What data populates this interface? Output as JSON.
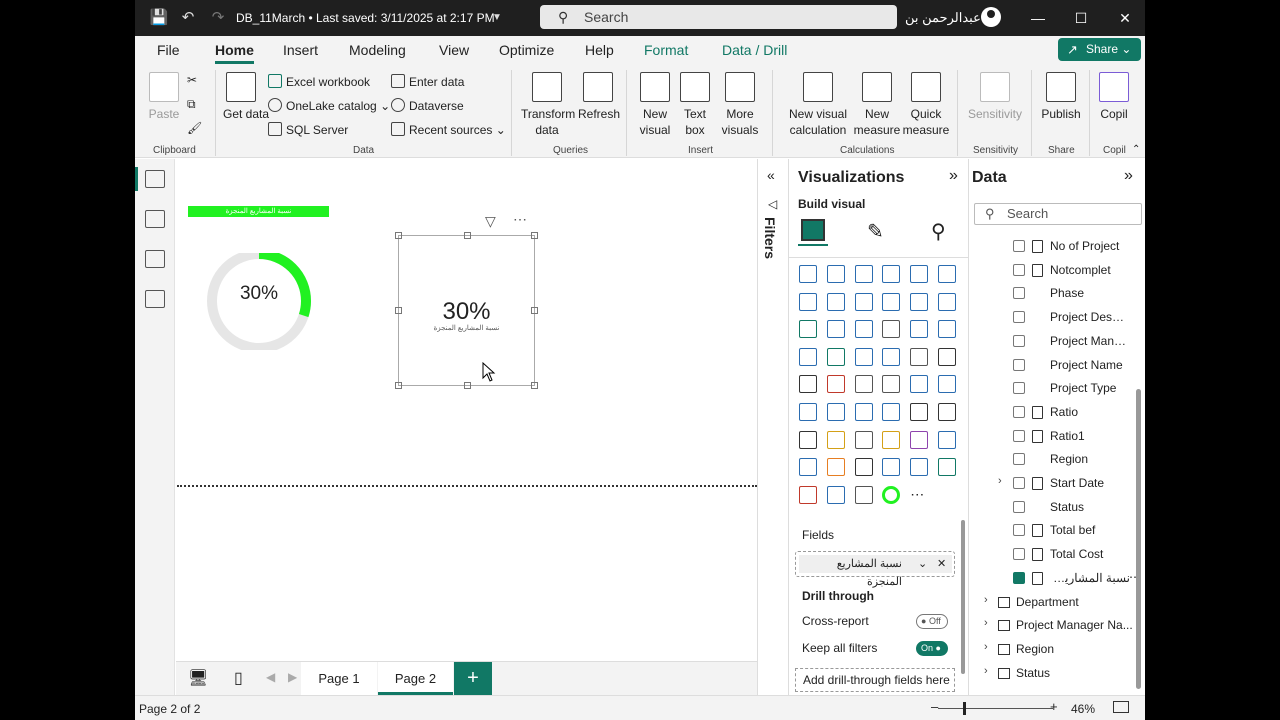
{
  "titlebar": {
    "title": "DB_11March • Last saved: 3/11/2025 at 2:17 PM",
    "search_placeholder": "Search",
    "user_name": "عبدالرحمن بن"
  },
  "menu": {
    "tabs": [
      "File",
      "Home",
      "Insert",
      "Modeling",
      "View",
      "Optimize",
      "Help",
      "Format",
      "Data / Drill"
    ],
    "active": "Home",
    "share_label": "Share"
  },
  "ribbon": {
    "clipboard": {
      "paste": "Paste",
      "label": "Clipboard"
    },
    "data": {
      "get_data": "Get data",
      "excel": "Excel workbook",
      "onelake": "OneLake catalog",
      "sql": "SQL Server",
      "enter_data": "Enter data",
      "dataverse": "Dataverse",
      "recent": "Recent sources",
      "label": "Data"
    },
    "queries": {
      "transform": "Transform data",
      "refresh": "Refresh",
      "label": "Queries"
    },
    "insert": {
      "new_visual": "New visual",
      "text_box": "Text box",
      "more_visuals": "More visuals",
      "label": "Insert"
    },
    "calculations": {
      "new_visual_calc": "New visual calculation",
      "new_measure": "New measure",
      "quick_measure": "Quick measure",
      "label": "Calculations"
    },
    "sensitivity": {
      "sensitivity": "Sensitivity",
      "label": "Sensitivity"
    },
    "share": {
      "publish": "Publish",
      "label": "Share"
    },
    "copilot": {
      "copilot": "Copil",
      "label": "Copil"
    }
  },
  "canvas": {
    "green_title": "نسبة المشاريع المنجزة",
    "donut_value": "30%",
    "donut_fraction": 0.3,
    "card_value": "30%",
    "card_caption": "نسبة المشاريع المنجزة"
  },
  "pages": {
    "tabs": [
      "Page 1",
      "Page 2"
    ],
    "active": "Page 2",
    "add": "+"
  },
  "status": {
    "page_indicator": "Page 2 of 2",
    "zoom": "46%"
  },
  "filters": {
    "label": "Filters"
  },
  "visualizations": {
    "title": "Visualizations",
    "build_visual": "Build visual",
    "fields_label": "Fields",
    "field_value": "نسبة المشاريع المنجزة",
    "drill_through": "Drill through",
    "cross_report": "Cross-report",
    "cross_report_state": "Off",
    "keep_filters": "Keep all filters",
    "keep_filters_state": "On",
    "add_drill": "Add drill-through fields here"
  },
  "data_pane": {
    "title": "Data",
    "search_placeholder": "Search",
    "fields": [
      {
        "label": "No of Project",
        "calc": true,
        "checked": false
      },
      {
        "label": "Notcomplet",
        "calc": true,
        "checked": false
      },
      {
        "label": "Phase",
        "calc": false,
        "checked": false
      },
      {
        "label": "Project Descri...",
        "calc": false,
        "checked": false
      },
      {
        "label": "Project Mana...",
        "calc": false,
        "checked": false
      },
      {
        "label": "Project Name",
        "calc": false,
        "checked": false
      },
      {
        "label": "Project Type",
        "calc": false,
        "checked": false
      },
      {
        "label": "Ratio",
        "calc": true,
        "checked": false
      },
      {
        "label": "Ratio1",
        "calc": true,
        "checked": false
      },
      {
        "label": "Region",
        "calc": false,
        "checked": false
      },
      {
        "label": "Start Date",
        "calc": true,
        "checked": false,
        "expandable": true
      },
      {
        "label": "Status",
        "calc": false,
        "checked": false
      },
      {
        "label": "Total bef",
        "calc": true,
        "checked": false
      },
      {
        "label": "Total Cost",
        "calc": true,
        "checked": false
      },
      {
        "label": "نسبة المشاريع المنجزة",
        "calc": true,
        "checked": true
      }
    ],
    "tables": [
      "Department",
      "Project Manager Na...",
      "Region",
      "Status"
    ]
  }
}
